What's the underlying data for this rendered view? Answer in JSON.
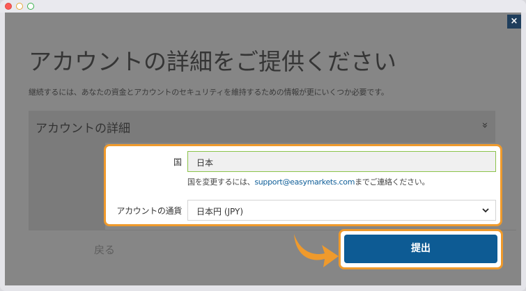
{
  "modal": {
    "close_glyph": "×",
    "title": "アカウントの詳細をご提供ください",
    "subtitle": "継続するには、あなたの資金とアカウントのセキュリティを維持するための情報が更にいくつか必要です。",
    "section_title": "アカウントの詳細",
    "section_chevron": "»",
    "back_label": "戻る"
  },
  "form": {
    "country_label": "国",
    "country_value": "日本",
    "help_prefix": "国を変更するには、",
    "help_email": "support@easymarkets.com",
    "help_suffix": "までご連絡ください。",
    "currency_label": "アカウントの通貨",
    "currency_value": "日本円 (JPY)",
    "submit_label": "提出"
  },
  "colors": {
    "highlight": "#ef9a2c",
    "primary": "#0d5b94",
    "overlay": "#868686"
  }
}
